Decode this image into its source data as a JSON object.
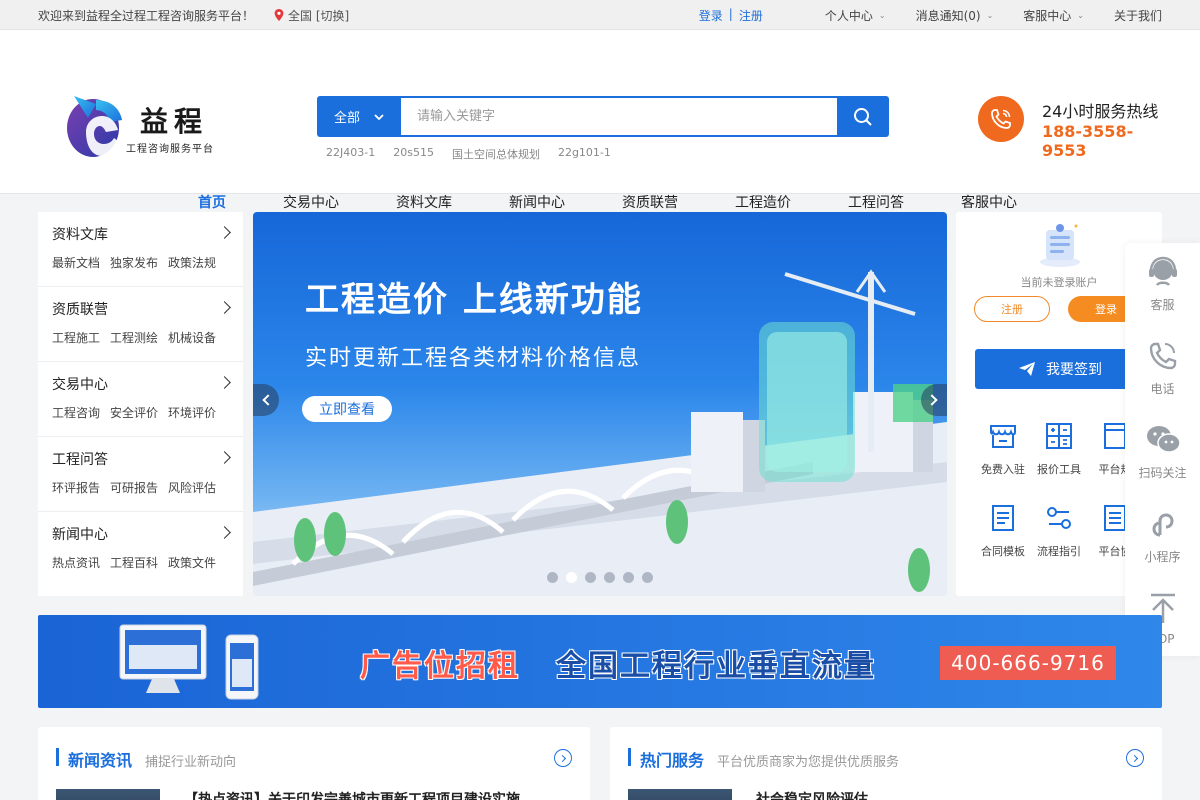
{
  "topbar": {
    "welcome": "欢迎来到益程全过程工程咨询服务平台！",
    "location": "全国 [切换]",
    "login": "登录",
    "separator": "|",
    "register": "注册",
    "menus": [
      "个人中心",
      "消息通知(0)",
      "客服中心",
      "关于我们"
    ]
  },
  "logo": {
    "name": "益程",
    "subtitle": "工程咨询服务平台"
  },
  "search": {
    "category": "全部",
    "placeholder": "请输入关键字",
    "hotwords": [
      "22J403-1",
      "20s515",
      "国土空间总体规划",
      "22g101-1"
    ]
  },
  "hotline": {
    "label": "24小时服务热线",
    "number": "188-3558-9553"
  },
  "nav": [
    "首页",
    "交易中心",
    "资料文库",
    "新闻中心",
    "资质联营",
    "工程造价",
    "工程问答",
    "客服中心"
  ],
  "categories": [
    {
      "title": "资料文库",
      "links": [
        "最新文档",
        "独家发布",
        "政策法规"
      ]
    },
    {
      "title": "资质联营",
      "links": [
        "工程施工",
        "工程测绘",
        "机械设备"
      ]
    },
    {
      "title": "交易中心",
      "links": [
        "工程咨询",
        "安全评价",
        "环境评价"
      ]
    },
    {
      "title": "工程问答",
      "links": [
        "环评报告",
        "可研报告",
        "风险评估"
      ]
    },
    {
      "title": "新闻中心",
      "links": [
        "热点资讯",
        "工程百科",
        "政策文件"
      ]
    }
  ],
  "banner": {
    "headline": "工程造价 上线新功能",
    "subline": "实时更新工程各类材料价格信息",
    "cta": "立即查看",
    "slide_count": 6,
    "active_slide": 2
  },
  "user_panel": {
    "status": "当前未登录账户",
    "register": "注册",
    "login": "登录",
    "signin": "我要签到",
    "tools": [
      "免费入驻",
      "报价工具",
      "平台规",
      "合同模板",
      "流程指引",
      "平台协"
    ]
  },
  "float_bar": [
    "客服",
    "电话",
    "扫码关注",
    "小程序",
    "TOP"
  ],
  "ad": {
    "text1": "广告位招租",
    "text2": "全国工程行业垂直流量",
    "phone": "400-666-9716"
  },
  "sections": {
    "news": {
      "title": "新闻资讯",
      "subtitle": "捕捉行业新动向",
      "headline": "【热点资讯】关于印发完善城市更新工程项目建设实施..."
    },
    "services": {
      "title": "热门服务",
      "subtitle": "平台优质商家为您提供优质服务",
      "headline": "社会稳定风险评估"
    }
  },
  "colors": {
    "primary": "#1b6fdc",
    "accent": "#ef6a1f",
    "background": "#f3f4f6"
  }
}
